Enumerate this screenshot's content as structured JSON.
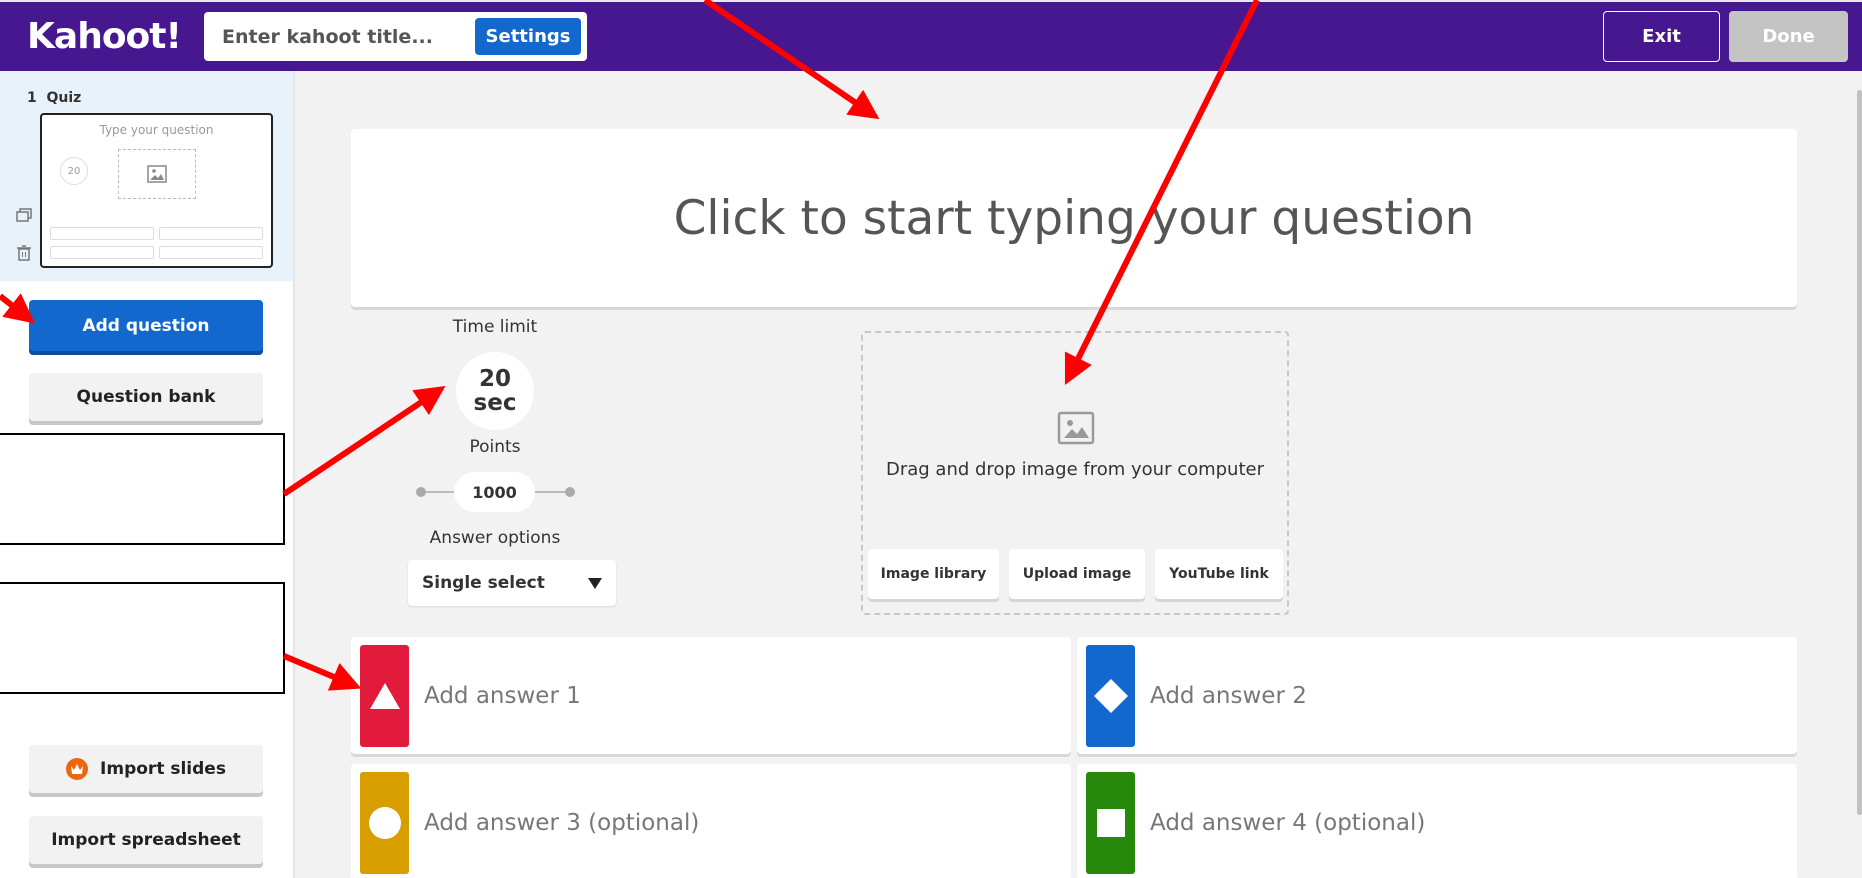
{
  "header": {
    "logo": "Kahoot!",
    "title_placeholder": "Enter kahoot title...",
    "settings_label": "Settings",
    "exit_label": "Exit",
    "done_label": "Done"
  },
  "sidebar": {
    "slide_number": "1",
    "slide_type": "Quiz",
    "thumb_question": "Type your question",
    "thumb_timer": "20",
    "add_question_label": "Add question",
    "question_bank_label": "Question bank",
    "import_slides_label": "Import slides",
    "import_spreadsheet_label": "Import spreadsheet"
  },
  "question": {
    "placeholder": "Click to start typing your question"
  },
  "settings": {
    "time_limit_label": "Time limit",
    "time_value": "20",
    "time_unit": "sec",
    "points_label": "Points",
    "points_value": "1000",
    "answer_options_label": "Answer options",
    "answer_option_selected": "Single select"
  },
  "media": {
    "drop_text": "Drag and drop image from your computer",
    "image_library": "Image library",
    "upload_image": "Upload image",
    "youtube_link": "YouTube link"
  },
  "answers": [
    {
      "placeholder": "Add answer 1",
      "color": "#e21b3c",
      "shape": "triangle-icon"
    },
    {
      "placeholder": "Add answer 2",
      "color": "#1368ce",
      "shape": "diamond-icon"
    },
    {
      "placeholder": "Add answer 3 (optional)",
      "color": "#d89e00",
      "shape": "circle-icon"
    },
    {
      "placeholder": "Add answer 4 (optional)",
      "color": "#26890c",
      "shape": "square-icon"
    }
  ],
  "colors": {
    "header_bg": "#46178f",
    "primary_blue": "#1368ce",
    "annotation_arrow": "#ff0000"
  }
}
